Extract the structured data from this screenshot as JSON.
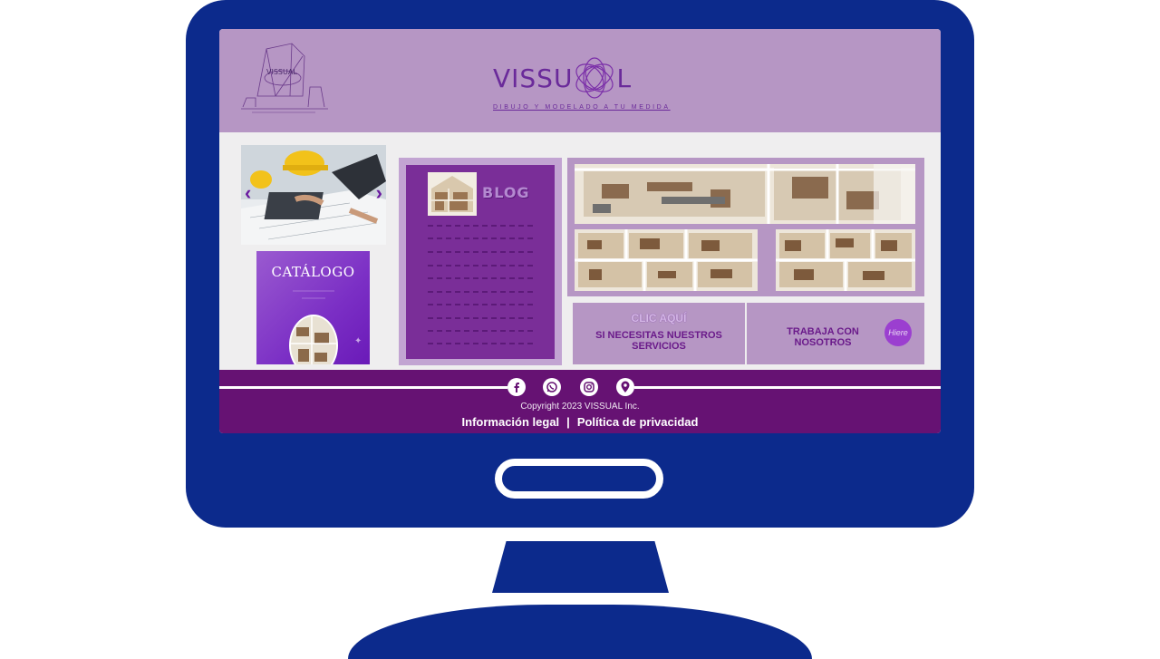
{
  "header": {
    "corner_logo_text": "VISSUAL",
    "brand_left": "VISSU",
    "brand_right": "L",
    "tagline": "DIBUJO Y MODELADO A TU MEDIDA"
  },
  "hero": {
    "prev_label": "‹",
    "next_label": "›"
  },
  "catalog": {
    "title": "CATÁLOGO"
  },
  "blog": {
    "title": "BLOG"
  },
  "cta_services": {
    "click_label": "CLIC AQUÍ",
    "text": "SI NECESITAS NUESTROS SERVICIOS"
  },
  "cta_work": {
    "text": "TRABAJA CON NOSOTROS",
    "badge": "Hiere"
  },
  "footer": {
    "copyright": "Copyright 2023 VISSUAL Inc.",
    "legal_link": "Información legal",
    "separator": "|",
    "privacy_link": "Política de privacidad",
    "social": [
      "facebook-icon",
      "whatsapp-icon",
      "instagram-icon",
      "location-pin-icon"
    ]
  },
  "colors": {
    "monitor": "#0c2a8c",
    "header_bg": "#b696c4",
    "footer_bg": "#661273",
    "accent_purple": "#7a2e98"
  }
}
